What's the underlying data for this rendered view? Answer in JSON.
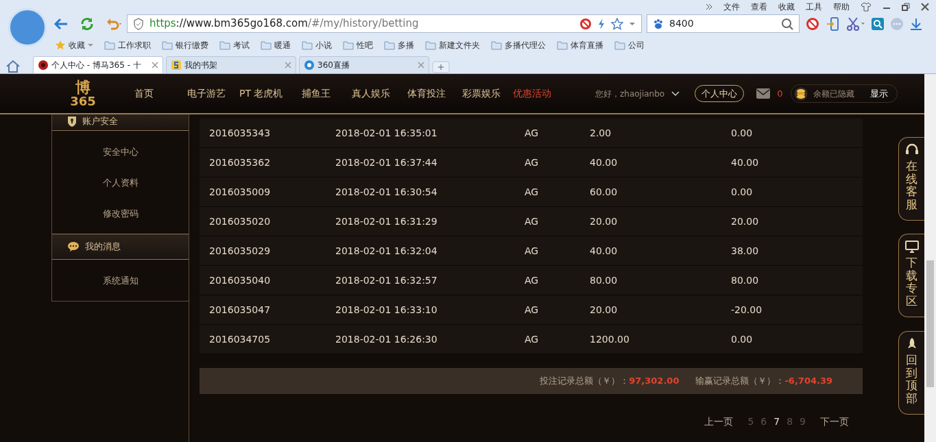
{
  "browser": {
    "menu": [
      "文件",
      "查看",
      "收藏",
      "工具",
      "帮助"
    ],
    "url": {
      "scheme": "https",
      "host": "://www.bm365go168.com",
      "path": "/#/my/history/betting"
    },
    "search": {
      "value": "8400"
    },
    "bookmarks": [
      {
        "label": "收藏",
        "kind": "star"
      },
      {
        "label": "工作求职",
        "kind": "folder"
      },
      {
        "label": "银行缴费",
        "kind": "folder"
      },
      {
        "label": "考试",
        "kind": "folder"
      },
      {
        "label": "暖通",
        "kind": "folder"
      },
      {
        "label": "小说",
        "kind": "folder"
      },
      {
        "label": "性吧",
        "kind": "folder"
      },
      {
        "label": "多播",
        "kind": "folder"
      },
      {
        "label": "新建文件夹",
        "kind": "folder"
      },
      {
        "label": "多播代理公",
        "kind": "folder"
      },
      {
        "label": "体育直播",
        "kind": "folder"
      },
      {
        "label": "公司",
        "kind": "folder"
      }
    ],
    "tabs": [
      {
        "title": "个人中心 - 博马365 - 十",
        "selected": true
      },
      {
        "title": "我的书架",
        "selected": false
      },
      {
        "title": "360直播",
        "selected": false
      }
    ]
  },
  "site": {
    "logo": [
      "博",
      "365"
    ],
    "nav": [
      {
        "label": "首页",
        "highlight": false
      },
      {
        "label": "电子游艺",
        "highlight": false
      },
      {
        "label": "PT 老虎机",
        "highlight": false
      },
      {
        "label": "捕鱼王",
        "highlight": false
      },
      {
        "label": "真人娱乐",
        "highlight": false
      },
      {
        "label": "体育投注",
        "highlight": false
      },
      {
        "label": "彩票娱乐",
        "highlight": false
      },
      {
        "label": "优惠活动",
        "highlight": true
      }
    ],
    "greeting": "您好，zhaojianbo",
    "personal_center": "个人中心",
    "mail_count": "0",
    "balance": "余额已隐藏",
    "show_button": "显示"
  },
  "sidebar": [
    {
      "title": "账户安全",
      "kind": "lock",
      "items": [
        "安全中心",
        "个人资料",
        "修改密码"
      ]
    },
    {
      "title": "我的消息",
      "kind": "chat",
      "items": [
        "系统通知"
      ]
    }
  ],
  "table": {
    "rows": [
      [
        "2016035343",
        "2018-02-01 16:35:01",
        "AG",
        "2.00",
        "0.00"
      ],
      [
        "2016035362",
        "2018-02-01 16:37:44",
        "AG",
        "40.00",
        "40.00"
      ],
      [
        "2016035009",
        "2018-02-01 16:30:54",
        "AG",
        "60.00",
        "0.00"
      ],
      [
        "2016035020",
        "2018-02-01 16:31:29",
        "AG",
        "20.00",
        "20.00"
      ],
      [
        "2016035029",
        "2018-02-01 16:32:04",
        "AG",
        "40.00",
        "38.00"
      ],
      [
        "2016035040",
        "2018-02-01 16:32:57",
        "AG",
        "80.00",
        "80.00"
      ],
      [
        "2016035047",
        "2018-02-01 16:33:10",
        "AG",
        "20.00",
        "-20.00"
      ],
      [
        "2016034705",
        "2018-02-01 16:26:30",
        "AG",
        "1200.00",
        "0.00"
      ]
    ]
  },
  "summary": [
    {
      "label": "投注记录总额（￥）：",
      "value": "97,302.00"
    },
    {
      "label": "输赢记录总额（￥）：",
      "value": "-6,704.39"
    }
  ],
  "pagination": {
    "prev": "上一页",
    "pages": [
      {
        "label": "5",
        "selected": false
      },
      {
        "label": "6",
        "selected": false
      },
      {
        "label": "7",
        "selected": true
      },
      {
        "label": "8",
        "selected": false
      },
      {
        "label": "9",
        "selected": false
      }
    ],
    "next": "下一页"
  },
  "float_buttons": [
    {
      "label": "在线客服",
      "kind": "headset"
    },
    {
      "label": "下载专区",
      "kind": "monitor"
    },
    {
      "label": "回到顶部",
      "kind": "rocket"
    }
  ]
}
